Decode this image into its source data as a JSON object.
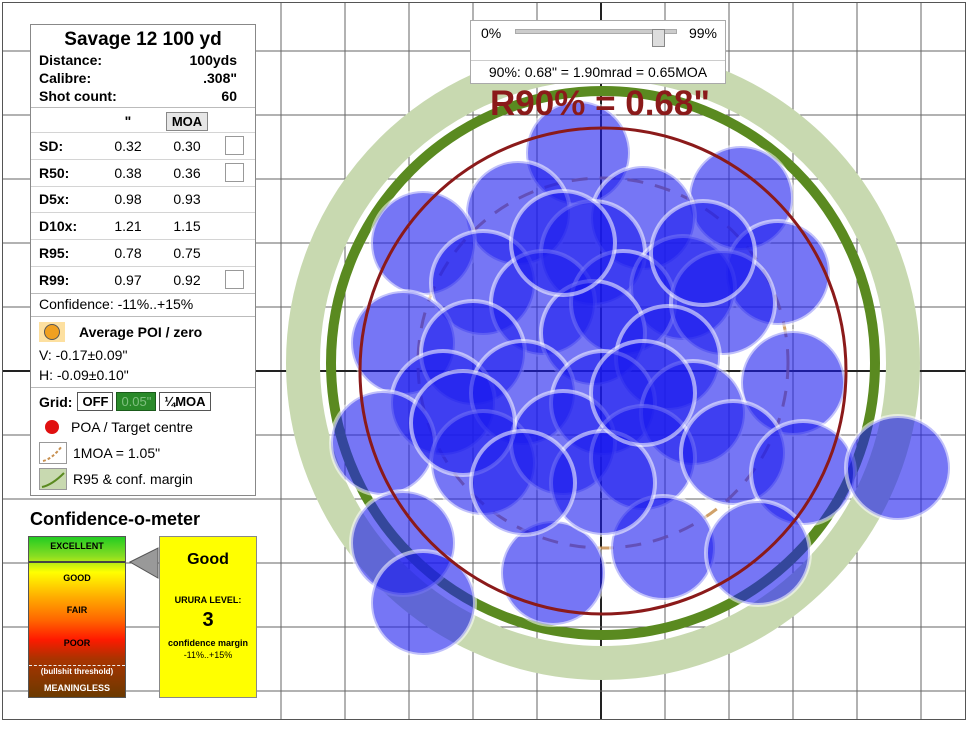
{
  "title": "Savage 12 100 yd",
  "info": [
    {
      "label": "Distance:",
      "value": "100yds"
    },
    {
      "label": "Calibre:",
      "value": ".308\""
    },
    {
      "label": "Shot count:",
      "value": "60"
    }
  ],
  "units": {
    "inch": "\"",
    "moa": "MOA"
  },
  "stats": [
    {
      "label": "SD:",
      "inch": "0.32",
      "moa": "0.30",
      "checkbox": true
    },
    {
      "label": "R50:",
      "inch": "0.38",
      "moa": "0.36",
      "checkbox": true
    },
    {
      "label": "D5x:",
      "inch": "0.98",
      "moa": "0.93",
      "checkbox": false
    },
    {
      "label": "D10x:",
      "inch": "1.21",
      "moa": "1.15",
      "checkbox": false
    },
    {
      "label": "R95:",
      "inch": "0.78",
      "moa": "0.75",
      "checkbox": false
    },
    {
      "label": "R99:",
      "inch": "0.97",
      "moa": "0.92",
      "checkbox": true
    }
  ],
  "confidence": "Confidence: -11%..+15%",
  "poi": {
    "label": "Average POI / zero",
    "v": "V: -0.17±0.09\"",
    "h": "H: -0.09±0.10\""
  },
  "grid": {
    "label": "Grid:",
    "off": "OFF",
    "mid": "0.05\"",
    "quarter": "¼MOA"
  },
  "legend": [
    {
      "icon": "red-dot-icon",
      "text": "POA / Target centre"
    },
    {
      "icon": "moa-dashed-arc-icon",
      "text": "1MOA = 1.05\""
    },
    {
      "icon": "r95-band-icon",
      "text": "R95 & conf. margin"
    }
  ],
  "meter": {
    "title": "Confidence-o-meter",
    "levels": [
      "EXCELLENT",
      "GOOD",
      "FAIR",
      "POOR",
      "(bullshit threshold)",
      "MEANINGLESS"
    ],
    "rating": "Good",
    "urura_label": "URURA LEVEL:",
    "urura_value": "3",
    "margin_label": "confidence margin",
    "margin_value": "-11%..+15%"
  },
  "slider": {
    "min": "0%",
    "max": "99%",
    "value_pct": 88,
    "caption": "90%: 0.68\" = 1.90mrad = 0.65MOA"
  },
  "r90_label": "R90% = 0.68\"",
  "colors": {
    "shot": "#1a1aee",
    "r95_band": "#c8d9b0",
    "r95_ring": "#5a8a20",
    "r90_ring": "#8b1a1a",
    "moa_arc": "#c89050",
    "grid": "#555555"
  }
}
